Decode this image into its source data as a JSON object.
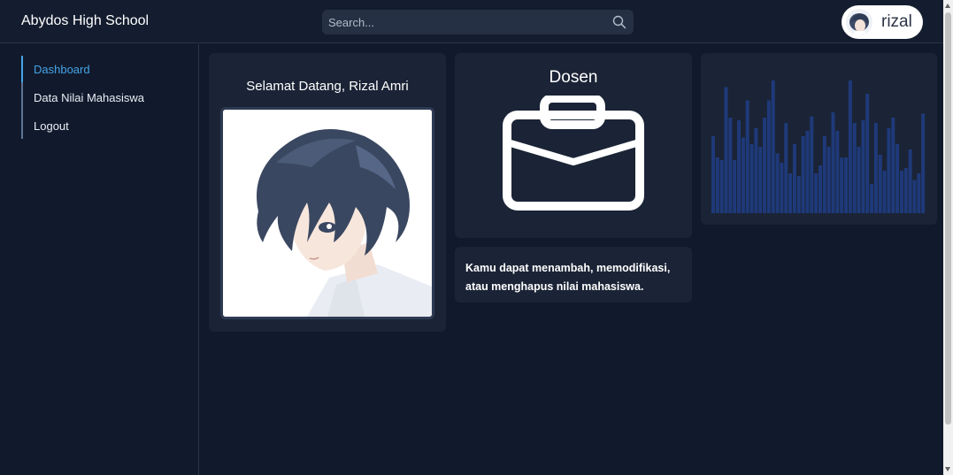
{
  "header": {
    "brand": "Abydos High School",
    "search_placeholder": "Search...",
    "user_name": "rizal"
  },
  "sidebar": {
    "items": [
      {
        "label": "Dashboard",
        "active": true
      },
      {
        "label": "Data Nilai Mahasiswa",
        "active": false
      },
      {
        "label": "Logout",
        "active": false
      }
    ]
  },
  "welcome_card": {
    "title": "Selamat Datang, Rizal Amri"
  },
  "role_card": {
    "title": "Dosen",
    "icon": "briefcase-icon"
  },
  "info_card": {
    "text": "Kamu dapat menambah, memodifikasi, atau menghapus nilai mahasiswa."
  },
  "colors": {
    "accent": "#45a3e6",
    "bar": "#1f3a7a",
    "background": "#111a2c",
    "card": "#1b2436"
  },
  "chart_data": {
    "type": "bar",
    "values": [
      58,
      42,
      40,
      95,
      72,
      40,
      70,
      57,
      85,
      52,
      64,
      50,
      72,
      85,
      100,
      45,
      38,
      68,
      30,
      52,
      28,
      58,
      62,
      73,
      30,
      36,
      58,
      50,
      76,
      62,
      42,
      42,
      100,
      68,
      50,
      70,
      90,
      22,
      68,
      44,
      32,
      64,
      72,
      52,
      32,
      34,
      48,
      25,
      30,
      75
    ]
  }
}
